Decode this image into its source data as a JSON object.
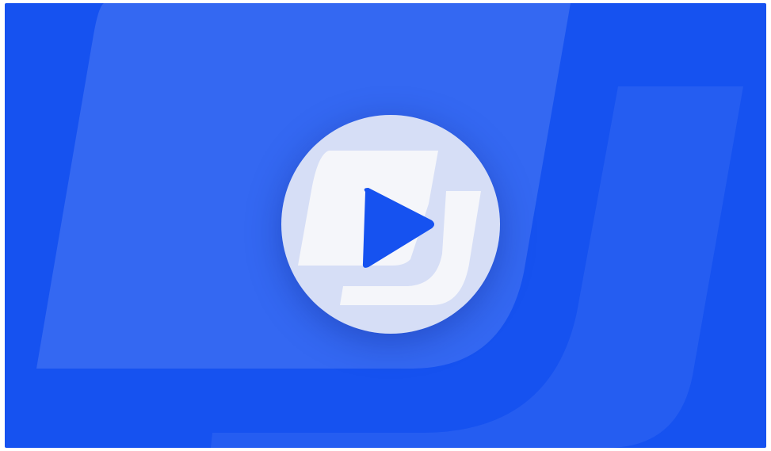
{
  "video_thumbnail": {
    "brand_color": "#1652F0",
    "overlay_color": "#D6DEF6",
    "logo_color": "#F5F6FA",
    "icons": {
      "background": "brand-logo-watermark-icon",
      "button_logo": "brand-logo-icon",
      "play": "play-icon"
    }
  }
}
